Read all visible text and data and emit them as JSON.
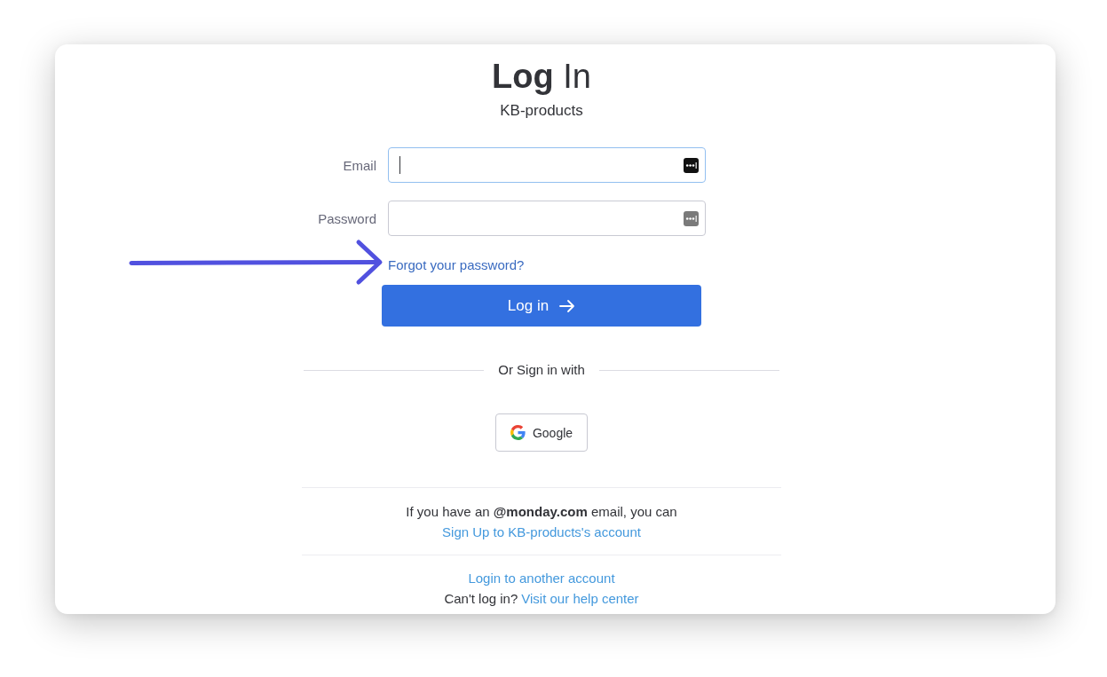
{
  "title": "**Log** In",
  "subtitle": "KB-products",
  "fields": [
    {
      "label": "Email",
      "focused": true
    },
    {
      "label": "Password",
      "focused": false
    }
  ],
  "forgot_link": "Forgot your password?",
  "login_button": "Log in",
  "divider_text": "Or Sign in with",
  "google_button": "Google",
  "signup_note": {
    "text": "If you have an **@monday.com** email, you can",
    "link": "Sign Up to KB-products's account"
  },
  "other_account_link": "Login to another account",
  "help": {
    "text": "Can't log in?",
    "link": "Visit our help center"
  }
}
